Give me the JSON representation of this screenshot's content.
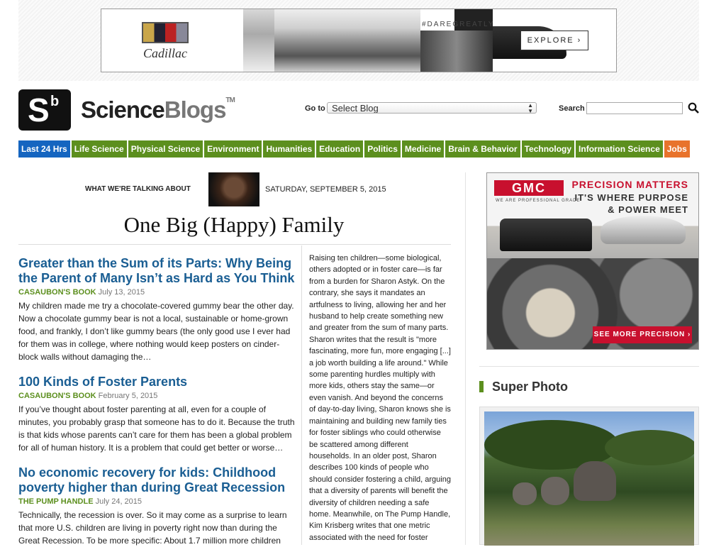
{
  "ad_top": {
    "brand": "Cadillac",
    "hashtag": "#DAREGREATLY",
    "cta": "EXPLORE ›"
  },
  "header": {
    "logo_letter": "S",
    "logo_sup": "b",
    "brand_science": "Science",
    "brand_blogs": "Blogs",
    "brand_tm": "TM",
    "goto_label": "Go to",
    "goto_select": "Select Blog",
    "search_label": "Search",
    "search_placeholder": ""
  },
  "nav": [
    {
      "label": "Last 24 Hrs"
    },
    {
      "label": "Life Science"
    },
    {
      "label": "Physical Science"
    },
    {
      "label": "Environment"
    },
    {
      "label": "Humanities"
    },
    {
      "label": "Education"
    },
    {
      "label": "Politics"
    },
    {
      "label": "Medicine"
    },
    {
      "label": "Brain & Behavior"
    },
    {
      "label": "Technology"
    },
    {
      "label": "Information Science"
    },
    {
      "label": "Jobs"
    }
  ],
  "feature": {
    "talking_label": "WHAT WE'RE TALKING ABOUT",
    "date": "SATURDAY, SEPTEMBER 5, 2015",
    "title": "One Big (Happy) Family",
    "body": "Raising ten children—some biological, others adopted or in foster care—is far from a burden for Sharon Astyk. On the contrary, she says it mandates an artfulness to living, allowing her and her husband to help create something new and greater from the sum of many parts. Sharon writes that the result is \"more fascinating, more fun, more engaging [...] a job worth building a life around.\" While some parenting hurdles multiply with more kids, others stay the same—or even vanish. And beyond the concerns of day-to-day living, Sharon knows she is maintaining and building new family ties for foster siblings who could otherwise be scattered among different households. In an older post, Sharon describes 100 kinds of people who should consider fostering a child, arguing that a diversity of parents will benefit the diversity of children needing a safe home. Meanwhile, on The Pump Handle, Kim Krisberg writes that one metric associated with the need for foster"
  },
  "articles": [
    {
      "title": "Greater than the Sum of its Parts: Why Being the Parent of Many Isn’t as Hard as You Think",
      "blog": "CASAUBON'S BOOK",
      "date": "July 13, 2015",
      "excerpt": "My children made me try a chocolate-covered gummy bear the other day. Now a chocolate gummy bear is not a local, sustainable or home-grown food, and frankly, I don’t like gummy bears (the only good use I ever had for them was in college, where nothing would keep posters on cinder-block walls without damaging the…"
    },
    {
      "title": "100 Kinds of Foster Parents",
      "blog": "CASAUBON'S BOOK",
      "date": "February 5, 2015",
      "excerpt": "If you’ve thought about foster parenting at all, even for a couple of minutes, you probably grasp that someone has to do it. Because the truth is that kids whose parents can’t care for them has been a global problem for all of human history. It is a problem that could get better or worse…"
    },
    {
      "title": "No economic recovery for kids: Childhood poverty higher than during Great Recession",
      "blog": "THE PUMP HANDLE",
      "date": "July 24, 2015",
      "excerpt": "Technically, the recession is over. So it may come as a surprise to learn that more U.S. children are living in poverty right now than during the Great Recession. To be more specific: About 1.7 million more children"
    }
  ],
  "gmc_ad": {
    "logo": "GMC",
    "sub": "WE ARE PROFESSIONAL GRADE",
    "headline": "PRECISION MATTERS",
    "tagline_1": "IT'S WHERE PURPOSE",
    "tagline_2": "& POWER MEET",
    "cta": "SEE MORE PRECISION ›"
  },
  "sidebar": {
    "super_photo_title": "Super Photo"
  },
  "colors": {
    "nav_green": "#5c8f1e",
    "nav_blue": "#1565c0",
    "nav_orange": "#e8732c",
    "link_blue": "#1a5e93",
    "gmc_red": "#c8102e"
  }
}
